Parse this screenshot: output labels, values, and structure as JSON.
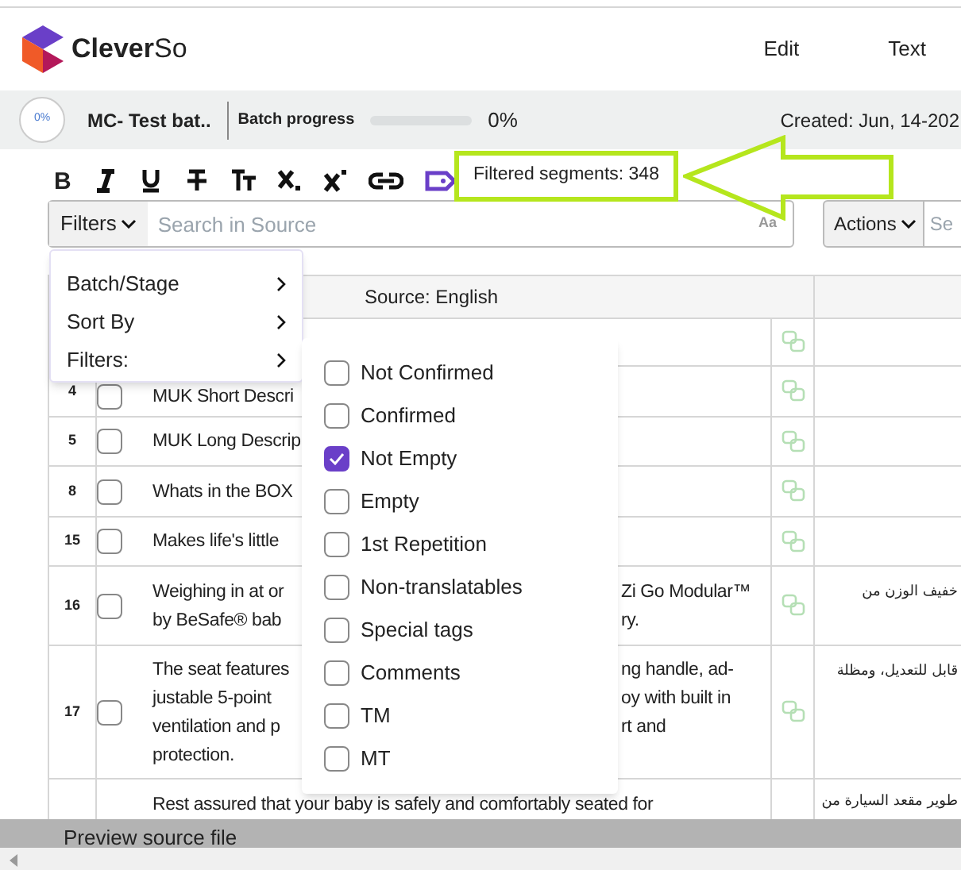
{
  "header": {
    "logo_text": "**Clever**So",
    "menu": [
      "Edit",
      "Text"
    ]
  },
  "batch_bar": {
    "progress_badge": "0%",
    "batch_name": "MC- Test bat..",
    "progress_label": "Batch progress",
    "progress": {
      "level": 0,
      "reading": "0%"
    },
    "created": "Created: Jun, 14-202"
  },
  "toolbar": {
    "buttons": [
      {
        "kind": "bold",
        "glyph": "B"
      },
      {
        "kind": "italic"
      },
      {
        "kind": "underline"
      },
      {
        "kind": "strike"
      },
      {
        "kind": "case"
      },
      {
        "kind": "sub"
      },
      {
        "kind": "sup"
      },
      {
        "kind": "link"
      },
      {
        "kind": "tag"
      }
    ],
    "filtered_count": "Filtered segments: 348"
  },
  "search": {
    "filters_button": "Filters",
    "placeholder": "Search in Source",
    "case_toggle": "Aa",
    "actions_button": "Actions",
    "search_2_placeholder": "Se"
  },
  "table": {
    "source_header": "Source: English",
    "rows": [
      {
        "translate_icon": true
      },
      {
        "number": "4",
        "checked": false,
        "lines": [
          {
            "left": "MUK Short Descri"
          }
        ],
        "translate_icon": true
      },
      {
        "number": "5",
        "checked": false,
        "lines": [
          {
            "left": "MUK Long Descrip"
          }
        ],
        "translate_icon": true
      },
      {
        "number": "8",
        "checked": false,
        "lines": [
          {
            "left": "Whats in the BOX"
          }
        ],
        "translate_icon": true
      },
      {
        "number": "15",
        "checked": false,
        "lines": [
          {
            "left": "Makes life's little"
          }
        ],
        "translate_icon": true
      },
      {
        "number": "16",
        "checked": false,
        "lines": [
          {
            "left": "Weighing in at or",
            "right": "Zi Go Modular™"
          },
          {
            "left": "by BeSafe® bab",
            "right": "ry."
          }
        ],
        "target": "خفيف الوزن من",
        "translate_icon": true
      },
      {
        "number": "17",
        "checked": false,
        "lines": [
          {
            "left": "The seat features",
            "right": "ng handle, ad-"
          },
          {
            "left": "justable 5-point",
            "right": "oy with built in"
          },
          {
            "left": "ventilation and p",
            "right": "rt and"
          },
          {
            "left": "protection."
          }
        ],
        "target": "قابل للتعديل، ومظلة",
        "translate_icon": true
      },
      {
        "lines": [
          {
            "left": "Rest assured that your baby is safely and comfortably seated for"
          }
        ],
        "target": "طوير مقعد السيارة من",
        "translate_icon": false
      }
    ]
  },
  "preview_bar": "Preview source file",
  "filters_menu": [
    "Batch/Stage",
    "Sort By",
    "Filters:"
  ],
  "filter_options": [
    {
      "label": "Not Confirmed",
      "checked": false
    },
    {
      "label": "Confirmed",
      "checked": false
    },
    {
      "label": "Not Empty",
      "checked": true
    },
    {
      "label": "Empty",
      "checked": false
    },
    {
      "label": "1st Repetition",
      "checked": false
    },
    {
      "label": "Non-translatables",
      "checked": false
    },
    {
      "label": "Special tags",
      "checked": false
    },
    {
      "label": "Comments",
      "checked": false
    },
    {
      "label": "TM",
      "checked": false
    },
    {
      "label": "MT",
      "checked": false
    }
  ]
}
